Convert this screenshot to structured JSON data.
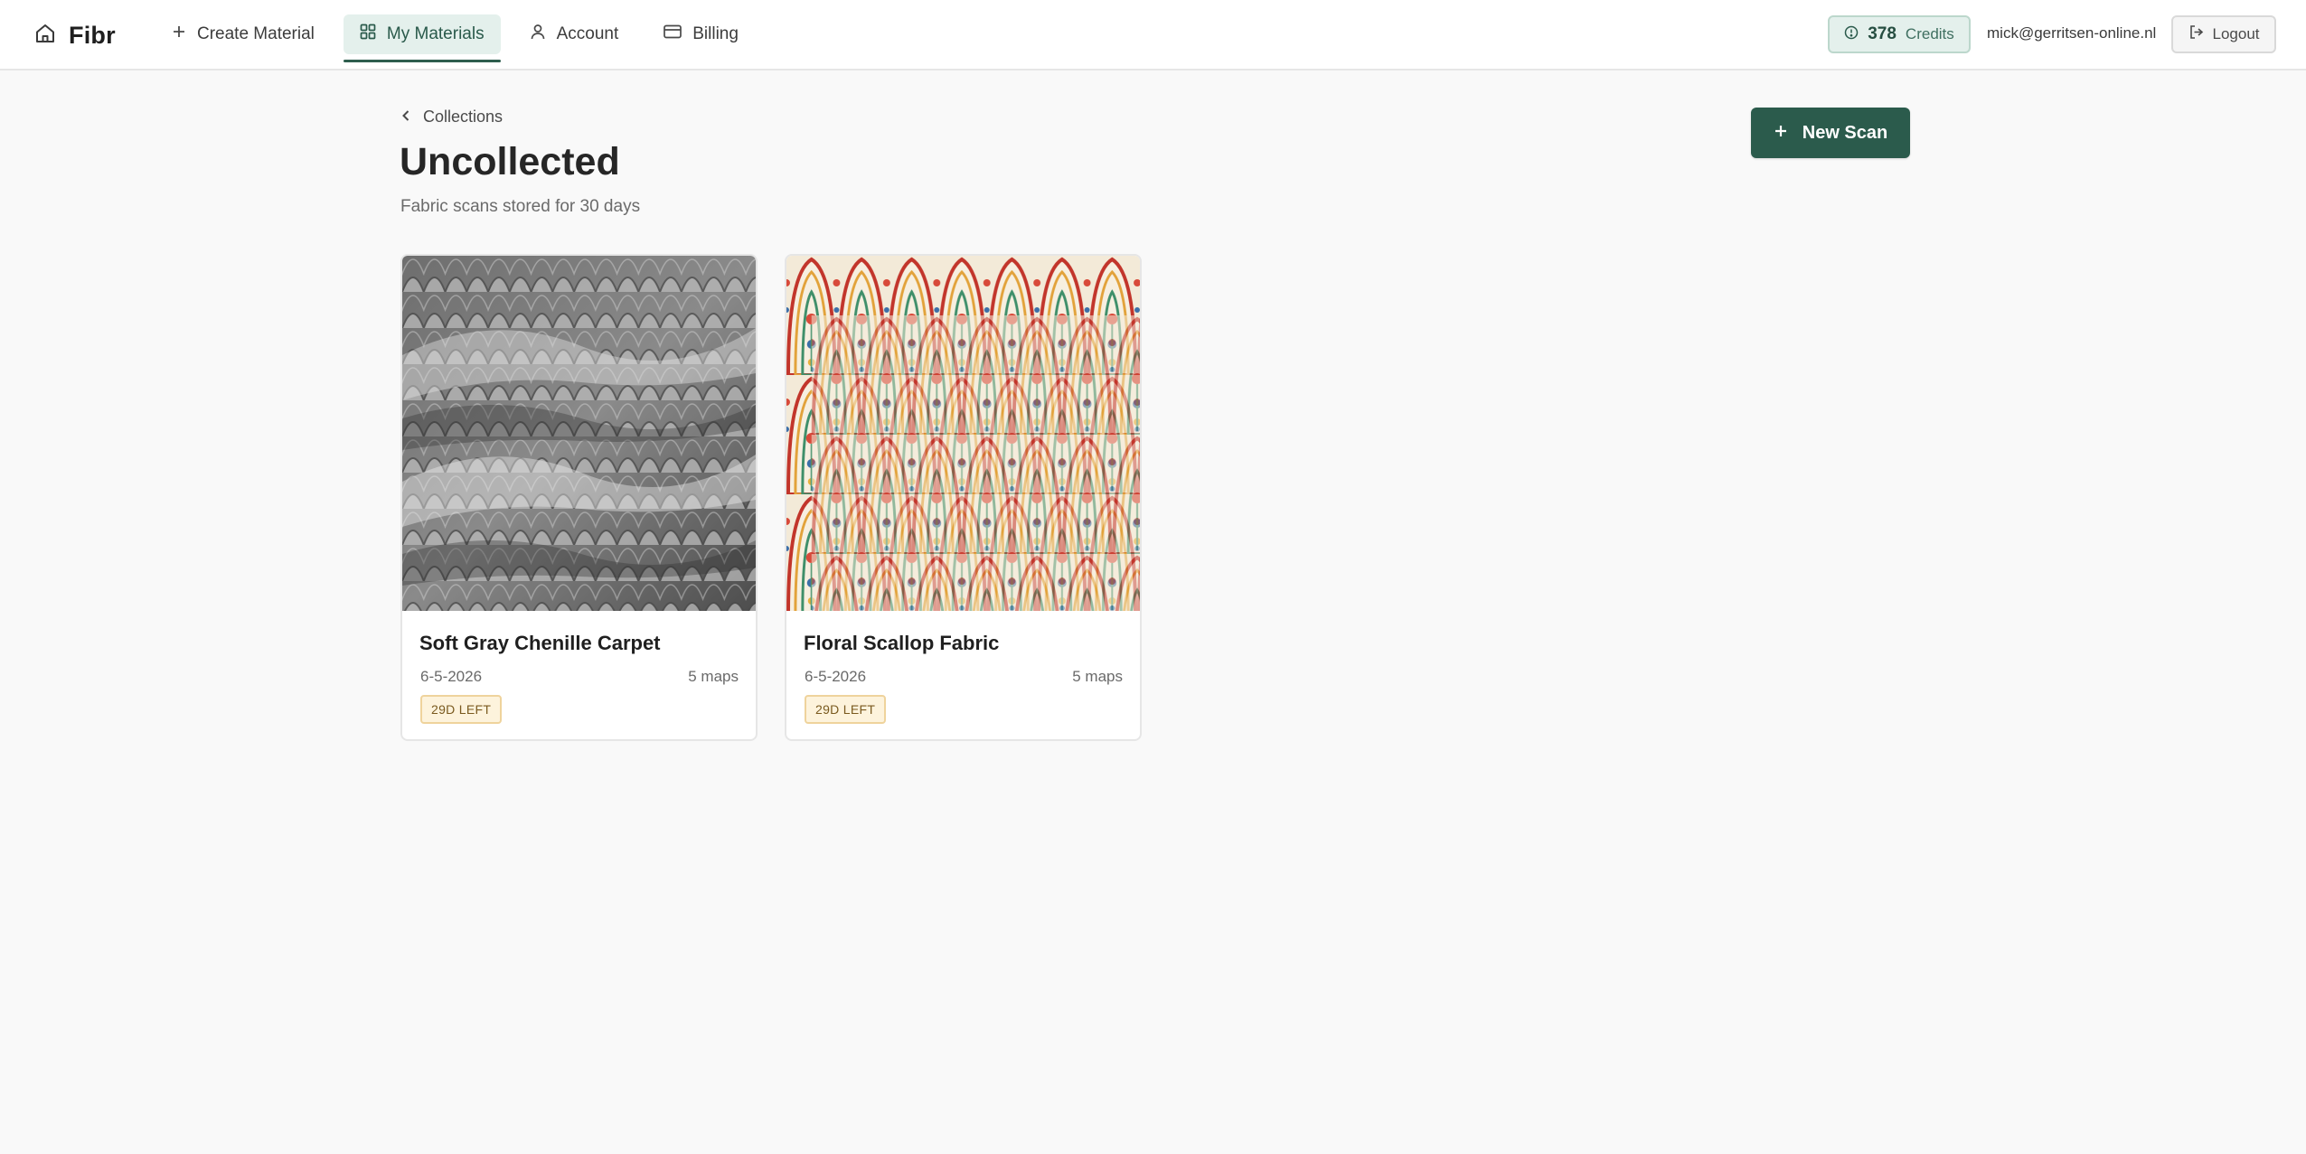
{
  "app": {
    "name": "Fibr"
  },
  "nav": {
    "create_material": "Create Material",
    "my_materials": "My Materials",
    "account": "Account",
    "billing": "Billing"
  },
  "header": {
    "credits_count": "378",
    "credits_label": "Credits",
    "user_email": "mick@gerritsen-online.nl",
    "logout_label": "Logout"
  },
  "page": {
    "back_label": "Collections",
    "title": "Uncollected",
    "subtitle": "Fabric scans stored for 30 days",
    "new_scan_label": "New Scan"
  },
  "materials": [
    {
      "name": "Soft Gray Chenille Carpet",
      "date": "6-5-2026",
      "maps": "5 maps",
      "badge": "29D LEFT"
    },
    {
      "name": "Floral Scallop Fabric",
      "date": "6-5-2026",
      "maps": "5 maps",
      "badge": "29D LEFT"
    }
  ],
  "colors": {
    "accent": "#2b5b4c",
    "accent_light": "#e4f0ec",
    "badge_bg": "#fdf3dc",
    "badge_text": "#7a5a1f"
  }
}
